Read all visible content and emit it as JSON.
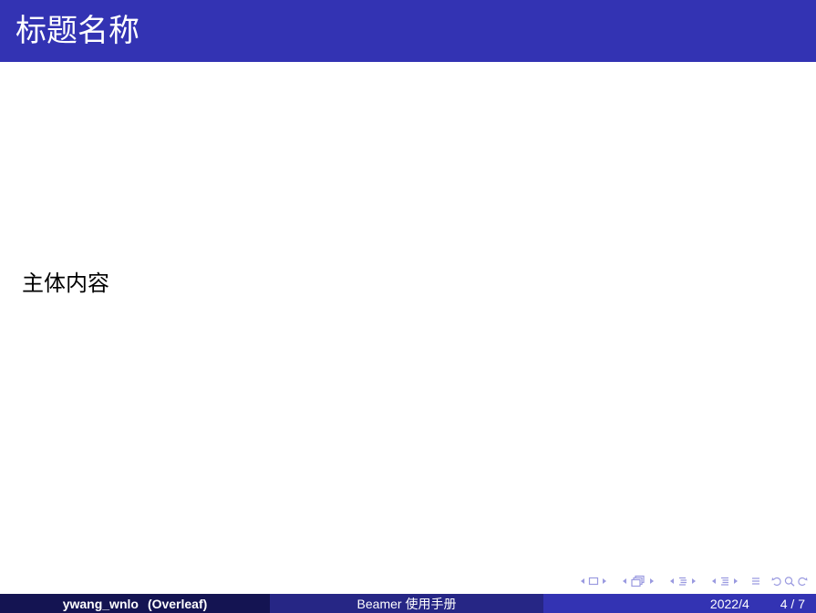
{
  "frame": {
    "title": "标题名称",
    "body": "主体内容"
  },
  "footline": {
    "author": "ywang_wnlo",
    "institute": "(Overleaf)",
    "short_title": "Beamer 使用手册",
    "date": "2022/4",
    "page": "4 / 7"
  },
  "navigation": {
    "icons": [
      "frame-nav",
      "subsection-nav",
      "section-nav",
      "presentation-nav",
      "align",
      "search"
    ]
  },
  "colors": {
    "title_bar": "#3333b3",
    "foot_left": "#141452",
    "foot_mid": "#262685",
    "foot_right": "#3333b3",
    "nav_icon": "#9a9ae0"
  }
}
